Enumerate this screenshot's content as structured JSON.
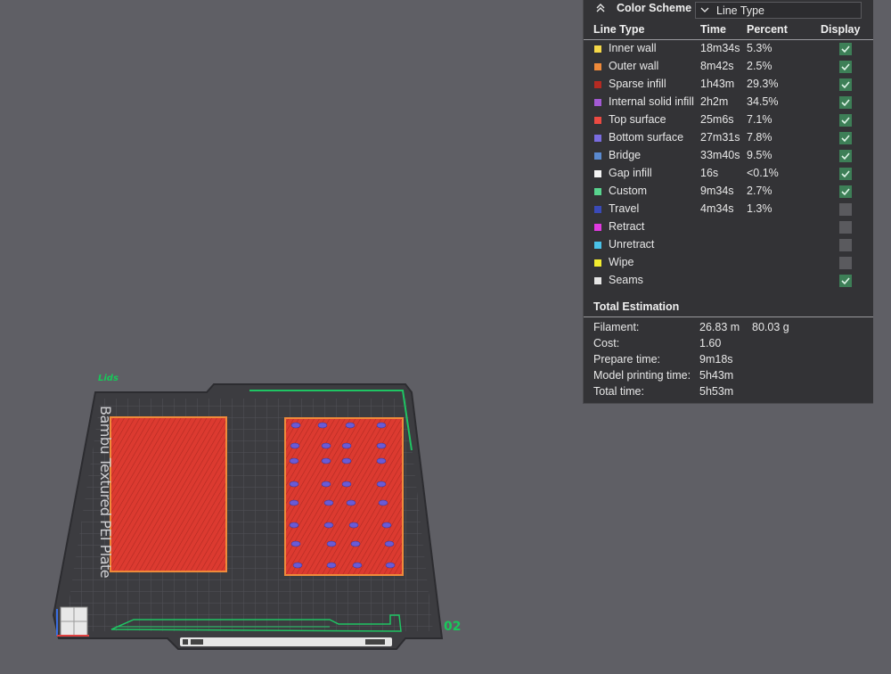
{
  "viewport": {
    "plate_name": "Lids",
    "plate_number": "02",
    "bed_label": "Bambu Textured PEI Plate"
  },
  "panel": {
    "title": "Color Scheme",
    "scheme_value": "Line Type",
    "columns": {
      "type": "Line Type",
      "time": "Time",
      "percent": "Percent",
      "display": "Display"
    },
    "rows": [
      {
        "name": "Inner wall",
        "time": "18m34s",
        "percent": "5.3%",
        "color": "#f5d848",
        "display": true
      },
      {
        "name": "Outer wall",
        "time": "8m42s",
        "percent": "2.5%",
        "color": "#ef8a3a",
        "display": true
      },
      {
        "name": "Sparse infill",
        "time": "1h43m",
        "percent": "29.3%",
        "color": "#b52a22",
        "display": true
      },
      {
        "name": "Internal solid infill",
        "time": "2h2m",
        "percent": "34.5%",
        "color": "#a35ad4",
        "display": true
      },
      {
        "name": "Top surface",
        "time": "25m6s",
        "percent": "7.1%",
        "color": "#ec4a42",
        "display": true
      },
      {
        "name": "Bottom surface",
        "time": "27m31s",
        "percent": "7.8%",
        "color": "#7a6ce0",
        "display": true
      },
      {
        "name": "Bridge",
        "time": "33m40s",
        "percent": "9.5%",
        "color": "#5a8ad0",
        "display": true
      },
      {
        "name": "Gap infill",
        "time": "16s",
        "percent": "<0.1%",
        "color": "#f4f4f4",
        "display": true
      },
      {
        "name": "Custom",
        "time": "9m34s",
        "percent": "2.7%",
        "color": "#58d48e",
        "display": true
      },
      {
        "name": "Travel",
        "time": "4m34s",
        "percent": "1.3%",
        "color": "#3a4ab8",
        "display": false
      },
      {
        "name": "Retract",
        "time": "",
        "percent": "",
        "color": "#e03ae0",
        "display": false
      },
      {
        "name": "Unretract",
        "time": "",
        "percent": "",
        "color": "#4ac2e8",
        "display": false
      },
      {
        "name": "Wipe",
        "time": "",
        "percent": "",
        "color": "#f2ec30",
        "display": false
      },
      {
        "name": "Seams",
        "time": "",
        "percent": "",
        "color": "#e6e6e6",
        "display": true
      }
    ],
    "total_title": "Total Estimation",
    "estimation": [
      {
        "label": "Filament:",
        "value": "26.83 m",
        "value2": "80.03 g"
      },
      {
        "label": "Cost:",
        "value": "1.60",
        "value2": ""
      },
      {
        "label": "Prepare time:",
        "value": "9m18s",
        "value2": ""
      },
      {
        "label": "Model printing time:",
        "value": "5h43m",
        "value2": ""
      },
      {
        "label": "Total time:",
        "value": "5h53m",
        "value2": ""
      }
    ]
  }
}
